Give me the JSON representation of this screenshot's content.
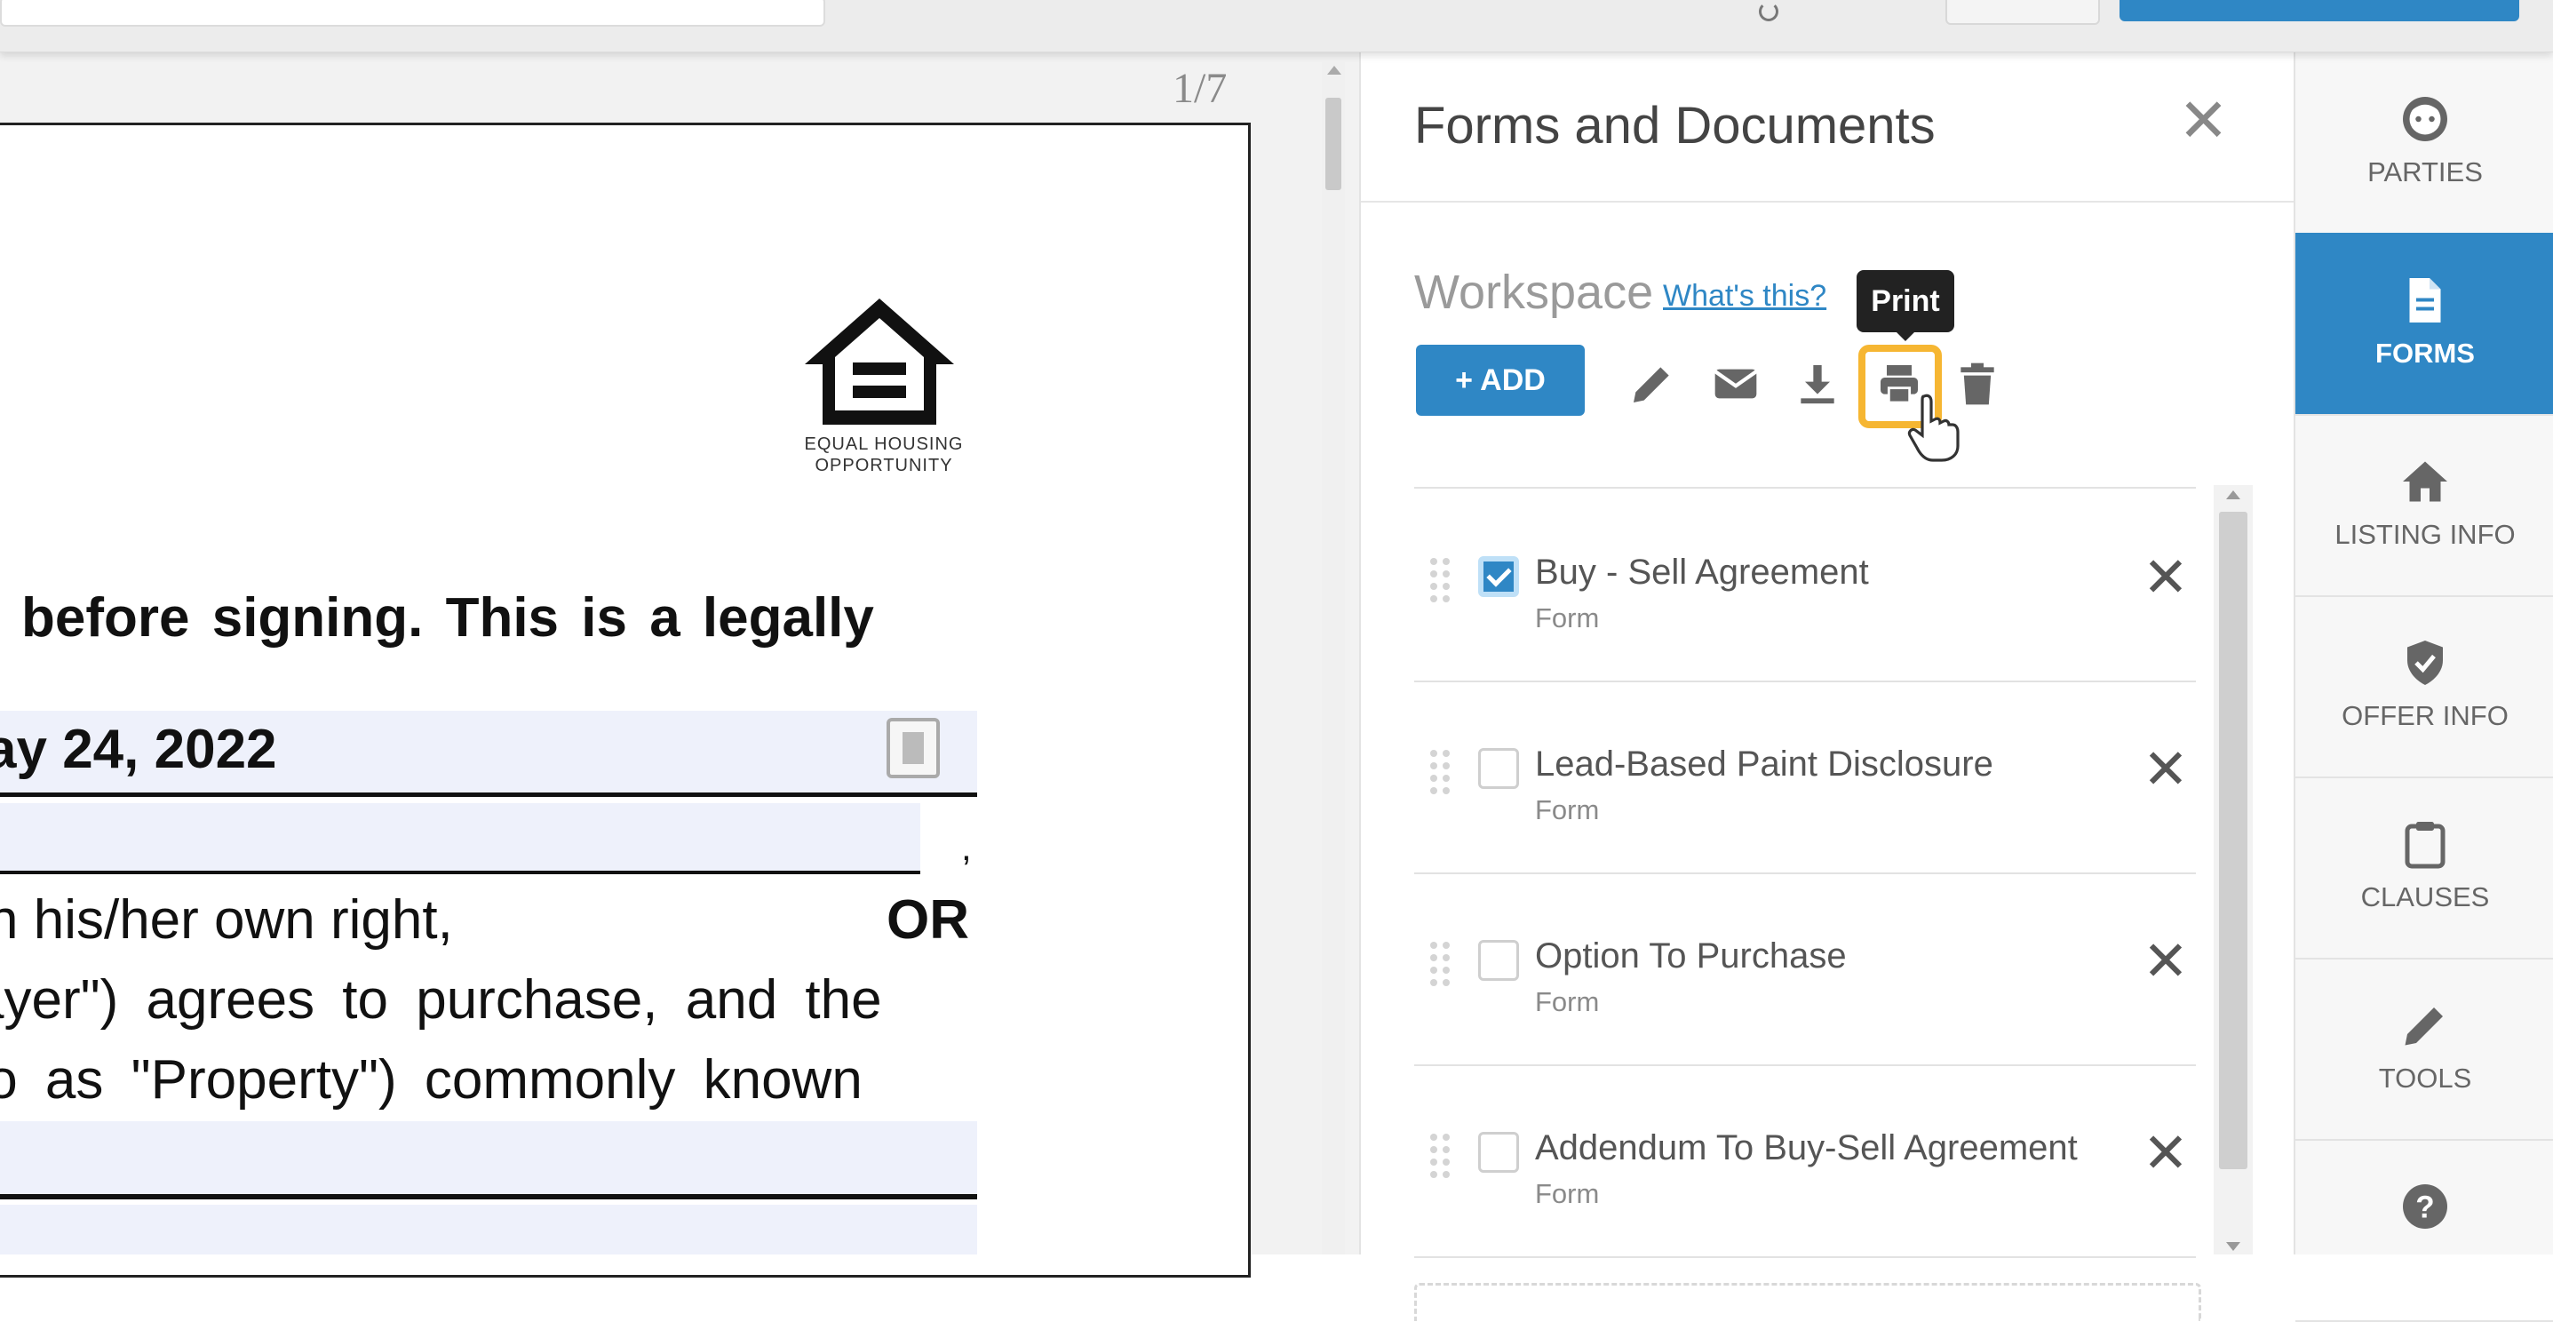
{
  "viewer": {
    "page_counter": "1/7",
    "logo_caption_line1": "EQUAL HOUSING",
    "logo_caption_line2": "OPPORTUNITY",
    "lines": [
      "before signing. This is a legally",
      "ay 24, 2022",
      ",",
      "n his/her own right,",
      "OR",
      "ayer\") agrees to purchase, and the",
      "to as \"Property\") commonly known"
    ]
  },
  "panel": {
    "title": "Forms and Documents",
    "workspace_label": "Workspace",
    "help_link": "What's this?",
    "tooltip": "Print",
    "add_button": "+ ADD",
    "items": [
      {
        "name": "Buy - Sell Agreement",
        "type": "Form",
        "checked": true
      },
      {
        "name": "Lead-Based Paint Disclosure",
        "type": "Form",
        "checked": false
      },
      {
        "name": "Option To Purchase",
        "type": "Form",
        "checked": false
      },
      {
        "name": "Addendum To Buy-Sell Agreement",
        "type": "Form",
        "checked": false
      }
    ]
  },
  "sidebar": {
    "items": [
      {
        "label": "PARTIES",
        "icon": "parties-icon"
      },
      {
        "label": "FORMS",
        "icon": "forms-icon",
        "active": true
      },
      {
        "label": "LISTING INFO",
        "icon": "home-icon"
      },
      {
        "label": "OFFER INFO",
        "icon": "shield-check-icon"
      },
      {
        "label": "CLAUSES",
        "icon": "clipboard-icon"
      },
      {
        "label": "TOOLS",
        "icon": "pencil-icon"
      },
      {
        "label": "",
        "icon": "help-icon"
      }
    ]
  },
  "colors": {
    "accent": "#2f87c5",
    "highlight": "#f6b632"
  }
}
